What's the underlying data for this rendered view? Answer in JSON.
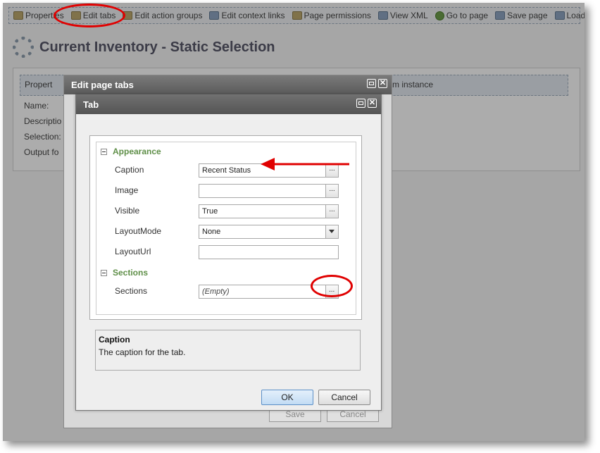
{
  "toolbar": {
    "items": [
      {
        "label": "Properties",
        "icon": "properties-icon"
      },
      {
        "label": "Edit tabs",
        "icon": "tabs-icon"
      },
      {
        "label": "Edit action groups",
        "icon": "action-groups-icon"
      },
      {
        "label": "Edit context links",
        "icon": "context-links-icon"
      },
      {
        "label": "Page permissions",
        "icon": "permissions-icon"
      },
      {
        "label": "View XML",
        "icon": "xml-icon"
      },
      {
        "label": "Go to page",
        "icon": "go-icon"
      },
      {
        "label": "Save page",
        "icon": "save-icon"
      },
      {
        "label": "Load page",
        "icon": "load-icon"
      }
    ]
  },
  "page": {
    "title": "Current Inventory - Static Selection",
    "bar_left": "Propert",
    "bar_right": "m instance",
    "fields": [
      "Name:",
      "Descriptio",
      "Selection:",
      "Output fo"
    ]
  },
  "outer_dialog": {
    "title": "Edit page tabs",
    "save_label": "Save",
    "cancel_label": "Cancel"
  },
  "tab_dialog": {
    "title": "Tab",
    "categories": {
      "appearance": "Appearance",
      "sections": "Sections"
    },
    "props": {
      "caption": {
        "label": "Caption",
        "value": "Recent Status"
      },
      "image": {
        "label": "Image",
        "value": ""
      },
      "visible": {
        "label": "Visible",
        "value": "True"
      },
      "layout_mode": {
        "label": "LayoutMode",
        "value": "None"
      },
      "layout_url": {
        "label": "LayoutUrl",
        "value": ""
      },
      "sections": {
        "label": "Sections",
        "value": "(Empty)"
      }
    },
    "ellipsis": "...",
    "description": {
      "title": "Caption",
      "text": "The caption for the tab."
    },
    "ok_label": "OK",
    "cancel_label": "Cancel"
  },
  "colors": {
    "callout": "#e00000",
    "category_text": "#5f8f48"
  }
}
